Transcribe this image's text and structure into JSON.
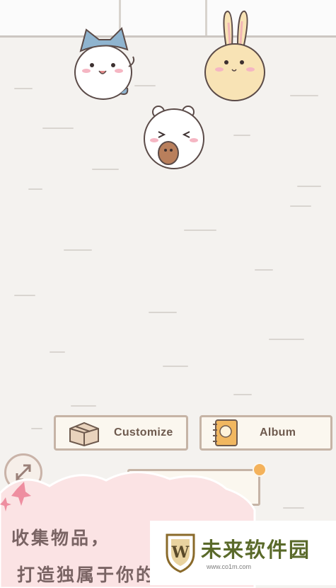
{
  "buttons": {
    "customize_label": "Customize",
    "album_label": "Album"
  },
  "promo": {
    "line1": "收集物品，",
    "line2": "打造独属于你的"
  },
  "watermark": {
    "title": "未来软件园",
    "url": "www.co1m.com",
    "emblem_letter": "W"
  },
  "colors": {
    "floor": "#f4f2ef",
    "button_border": "#c6b4a6",
    "accent_orange": "#f4b25b",
    "promo_pink": "#fbe3e4"
  },
  "icons": [
    "cardboard-box-icon",
    "photo-album-icon",
    "expand-arrows-icon"
  ]
}
